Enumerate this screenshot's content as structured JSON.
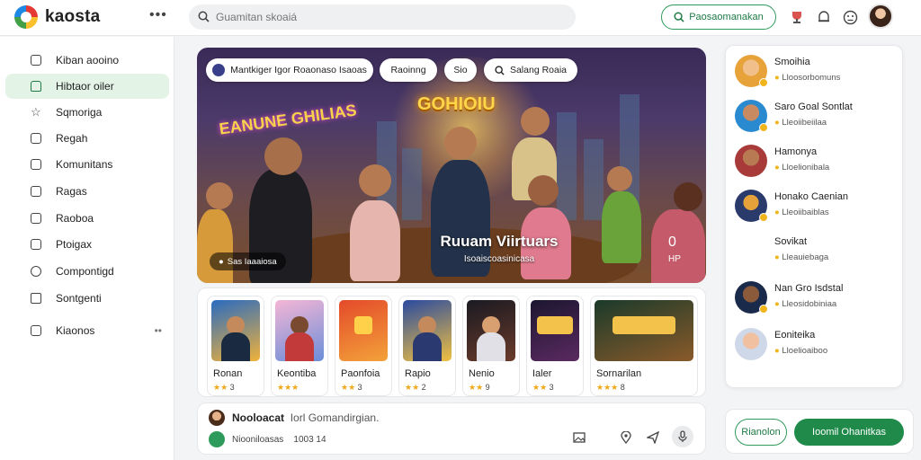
{
  "app": {
    "name": "kaosta"
  },
  "search": {
    "placeholder": "Guamitan skoaiá"
  },
  "header": {
    "primary_action": "Paosaomanakan"
  },
  "sidebar": {
    "items": [
      {
        "label": "Kiban aooino",
        "icon": "play-icon"
      },
      {
        "label": "Hibtaor oiler",
        "icon": "home-icon",
        "active": true
      },
      {
        "label": "Sqmoriga",
        "icon": "star-icon"
      },
      {
        "label": "Regah",
        "icon": "calendar-icon"
      },
      {
        "label": "Komunitans",
        "icon": "community-icon"
      },
      {
        "label": "Ragas",
        "icon": "image-icon"
      },
      {
        "label": "Raoboa",
        "icon": "info-icon"
      },
      {
        "label": "Ptoigax",
        "icon": "edit-icon"
      },
      {
        "label": "Compontigd",
        "icon": "compass-icon"
      },
      {
        "label": "Sontgenti",
        "icon": "square-icon"
      },
      {
        "label": "Kiaonos",
        "icon": "settings-icon",
        "more": "••"
      }
    ]
  },
  "hero": {
    "chips": [
      "Mantkiger Igor Roaonaso Isaoas",
      "Raoinng",
      "Sio",
      "Salang Roaia"
    ],
    "sign_left": "EANUNE GHILIAS",
    "sign_center": "GOHIOIU",
    "title": "Ruuam Viirtuars",
    "subtitle": "Isoaiscoasinicasa",
    "players": "Sas Iaaaiosa",
    "count": "0",
    "count_label": "HP"
  },
  "games": [
    {
      "name": "Ronan",
      "rating": "3",
      "stars": "★★"
    },
    {
      "name": "Keontiba",
      "rating": "",
      "stars": "★★★"
    },
    {
      "name": "Paonfoia",
      "rating": "3",
      "stars": "★★"
    },
    {
      "name": "Rapio",
      "rating": "2",
      "stars": "★★"
    },
    {
      "name": "Nenio",
      "rating": "9",
      "stars": "★★"
    },
    {
      "name": "Ialer",
      "rating": "3",
      "stars": "★★"
    },
    {
      "name": "Sornarilan",
      "rating": "8",
      "stars": "★★★"
    }
  ],
  "composer": {
    "author": "Nooloacat",
    "text": "Iorl Gomandirgian.",
    "meta": "Niooniloasas",
    "meta_count": "1003 14"
  },
  "friends": [
    {
      "name": "Smoihia",
      "status": "Lloosorbomuns"
    },
    {
      "name": "Saro Goal Sontlat",
      "status": "Lleoiibeiilaa"
    },
    {
      "name": "Hamonya",
      "status": "Lloelionibala"
    },
    {
      "name": "Honako Caenian",
      "status": "Lleoiibaiblas"
    },
    {
      "name": "Sovikat",
      "status": "Lleauiebaga"
    },
    {
      "name": "Nan Gro Isdstal",
      "status": "Lleosidobiniaa"
    },
    {
      "name": "Eoniteika",
      "status": "Lloelioaiboo"
    }
  ],
  "actions": {
    "secondary": "Rianolon",
    "primary": "Ioomil Ohanitkas"
  },
  "colors": {
    "accent": "#2e9a5b",
    "accent_dark": "#1f8a4a",
    "active_bg": "#e3f4e7",
    "star": "#f0a81a"
  }
}
